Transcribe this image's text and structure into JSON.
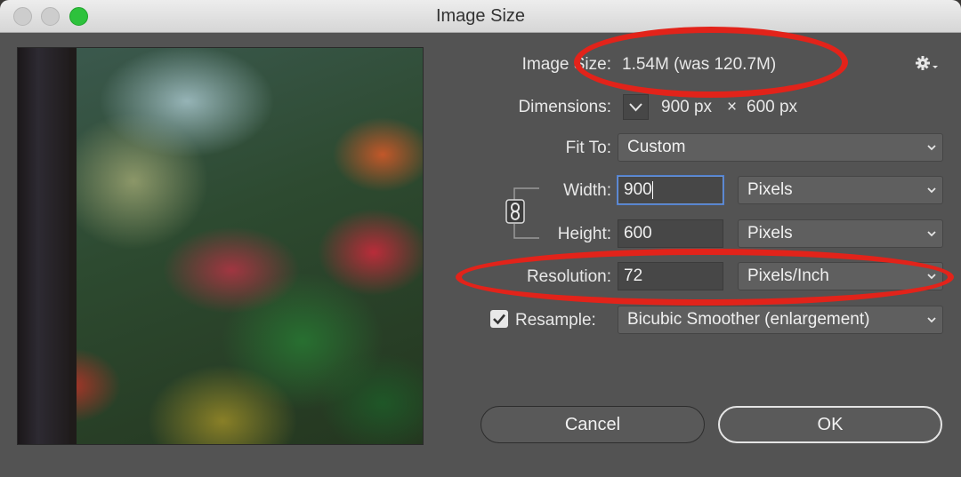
{
  "window": {
    "title": "Image Size"
  },
  "image_size": {
    "label": "Image Size:",
    "value": "1.54M (was 120.7M)"
  },
  "dimensions": {
    "label": "Dimensions:",
    "width": "900 px",
    "times": "×",
    "height": "600 px"
  },
  "fit_to": {
    "label": "Fit To:",
    "value": "Custom"
  },
  "width": {
    "label": "Width:",
    "value": "900",
    "unit": "Pixels"
  },
  "height": {
    "label": "Height:",
    "value": "600",
    "unit": "Pixels"
  },
  "resolution": {
    "label": "Resolution:",
    "value": "72",
    "unit": "Pixels/Inch"
  },
  "resample": {
    "label": "Resample:",
    "checked": true,
    "method": "Bicubic Smoother (enlargement)"
  },
  "buttons": {
    "cancel": "Cancel",
    "ok": "OK"
  },
  "colors": {
    "annotation": "#e2231a",
    "zoom_light": "#2dc23c",
    "dialog_bg": "#535353"
  }
}
